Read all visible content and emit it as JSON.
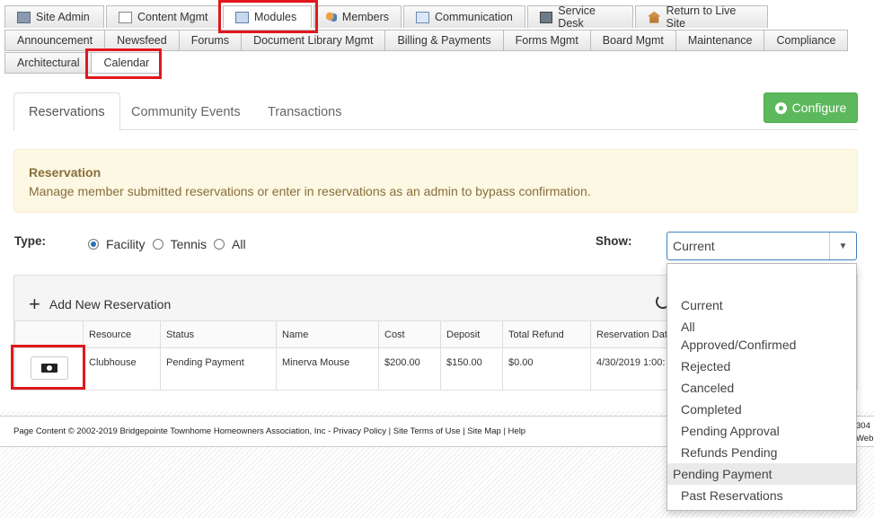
{
  "top_tabs": [
    {
      "label": "Site Admin",
      "icon": "site-admin-icon"
    },
    {
      "label": "Content Mgmt",
      "icon": "content-icon"
    },
    {
      "label": "Modules",
      "icon": "modules-icon"
    },
    {
      "label": "Members",
      "icon": "members-icon"
    },
    {
      "label": "Communication",
      "icon": "communication-icon"
    },
    {
      "label": "Service Desk",
      "icon": "service-desk-icon"
    },
    {
      "label": "Return to Live Site",
      "icon": "home-icon"
    }
  ],
  "module_tabs": [
    "Announcement",
    "Newsfeed",
    "Forums",
    "Document Library Mgmt",
    "Billing & Payments",
    "Forms Mgmt",
    "Board Mgmt",
    "Maintenance",
    "Compliance"
  ],
  "module_tabs_row2": [
    "Architectural",
    "Calendar"
  ],
  "sub_tabs": [
    "Reservations",
    "Community Events",
    "Transactions"
  ],
  "configure_label": "Configure",
  "alert": {
    "title": "Reservation",
    "text": "Manage member submitted reservations or enter in reservations as an admin to bypass confirmation."
  },
  "type_filter": {
    "label": "Type:",
    "options": [
      "Facility",
      "Tennis",
      "All"
    ],
    "selected": "Facility"
  },
  "show_filter": {
    "label": "Show:",
    "value": "Current",
    "options": [
      "",
      "Current",
      "All",
      "Approved/Confirmed",
      "Rejected",
      "Canceled",
      "Completed",
      "Pending Approval",
      "Refunds Pending",
      "Pending Payment",
      "Past Reservations"
    ],
    "highlighted": "Pending Payment"
  },
  "grid": {
    "add_label": "Add New Reservation",
    "columns": [
      "",
      "Resource",
      "Status",
      "Name",
      "Cost",
      "Deposit",
      "Total Refund",
      "Reservation Dat"
    ],
    "rows": [
      [
        "",
        "Clubhouse",
        "Pending Payment",
        "Minerva Mouse",
        "$200.00",
        "$150.00",
        "$0.00",
        "4/30/2019 1:00:"
      ]
    ]
  },
  "footer": {
    "text": "Page Content © 2002-2019 Bridgepointe Townhome Homeowners Association, Inc  - Privacy Policy  | Site Terms of Use  | Site Map  | Help",
    "right_1": "304",
    "right_2": "Web"
  }
}
